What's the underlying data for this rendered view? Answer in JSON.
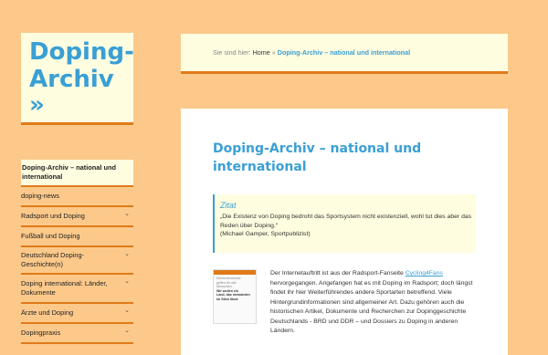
{
  "site": {
    "logo_line1": "Doping-",
    "logo_line2": "Archiv",
    "logo_arrow": "»"
  },
  "sidebar": {
    "items": [
      {
        "label": "Doping-Archiv – national und international",
        "active": true,
        "expandable": false
      },
      {
        "label": "doping-news",
        "active": false,
        "expandable": false
      },
      {
        "label": "Radsport und Doping",
        "active": false,
        "expandable": true
      },
      {
        "label": "Fußball und Doping",
        "active": false,
        "expandable": false
      },
      {
        "label": "Deutschland Doping-Geschichte(n)",
        "active": false,
        "expandable": true
      },
      {
        "label": "Doping international: Länder, Dokumente",
        "active": false,
        "expandable": true
      },
      {
        "label": "Ärzte und Doping",
        "active": false,
        "expandable": true
      },
      {
        "label": "Dopingpraxis",
        "active": false,
        "expandable": true
      }
    ],
    "chevron": "chevron-down-icon"
  },
  "breadcrumb": {
    "prefix": "Sie sind hier:",
    "home": "Home",
    "separator": "»",
    "current": "Doping-Archiv – national und international"
  },
  "main": {
    "title": "Doping-Archiv – national und international",
    "quote_label": "Zitat",
    "quote_text": "„Die Existenz von Doping bedroht das Sportsystem nicht existenziell, wohl tut dies aber das Reden über Doping.“",
    "quote_author": "(Michael Gamper, Sportpublizist)",
    "thumb_lines": [
      "Menschenrechte",
      "gelten für alle",
      "Menschen."
    ],
    "thumb_bold": [
      "Wir wollen ein",
      "Land, das niemanden",
      "im Stich lässt."
    ],
    "body_before_link": "Der Internetauftritt ist aus der Radsport-Fanseite ",
    "body_link": "Cycling4Fans",
    "body_after_link": " hervorgegangen. Angefangen hat es mit Doping im Radsport; doch längst findet ihr hier Weiterführendes andere Sportarten betreffend. Viele Hintergrundinformationen sind allgemeiner Art. Dazu gehören auch die historischen Artikel, Dokumente und Recherchen zur Dopinggeschichte Deutschlands - BRD und DDR – und Dossiers zu Doping in anderen Ländern."
  },
  "colors": {
    "background": "#fcc98a",
    "accent": "#3a9fd4",
    "border": "#e07a19",
    "panel": "#fffde0"
  }
}
